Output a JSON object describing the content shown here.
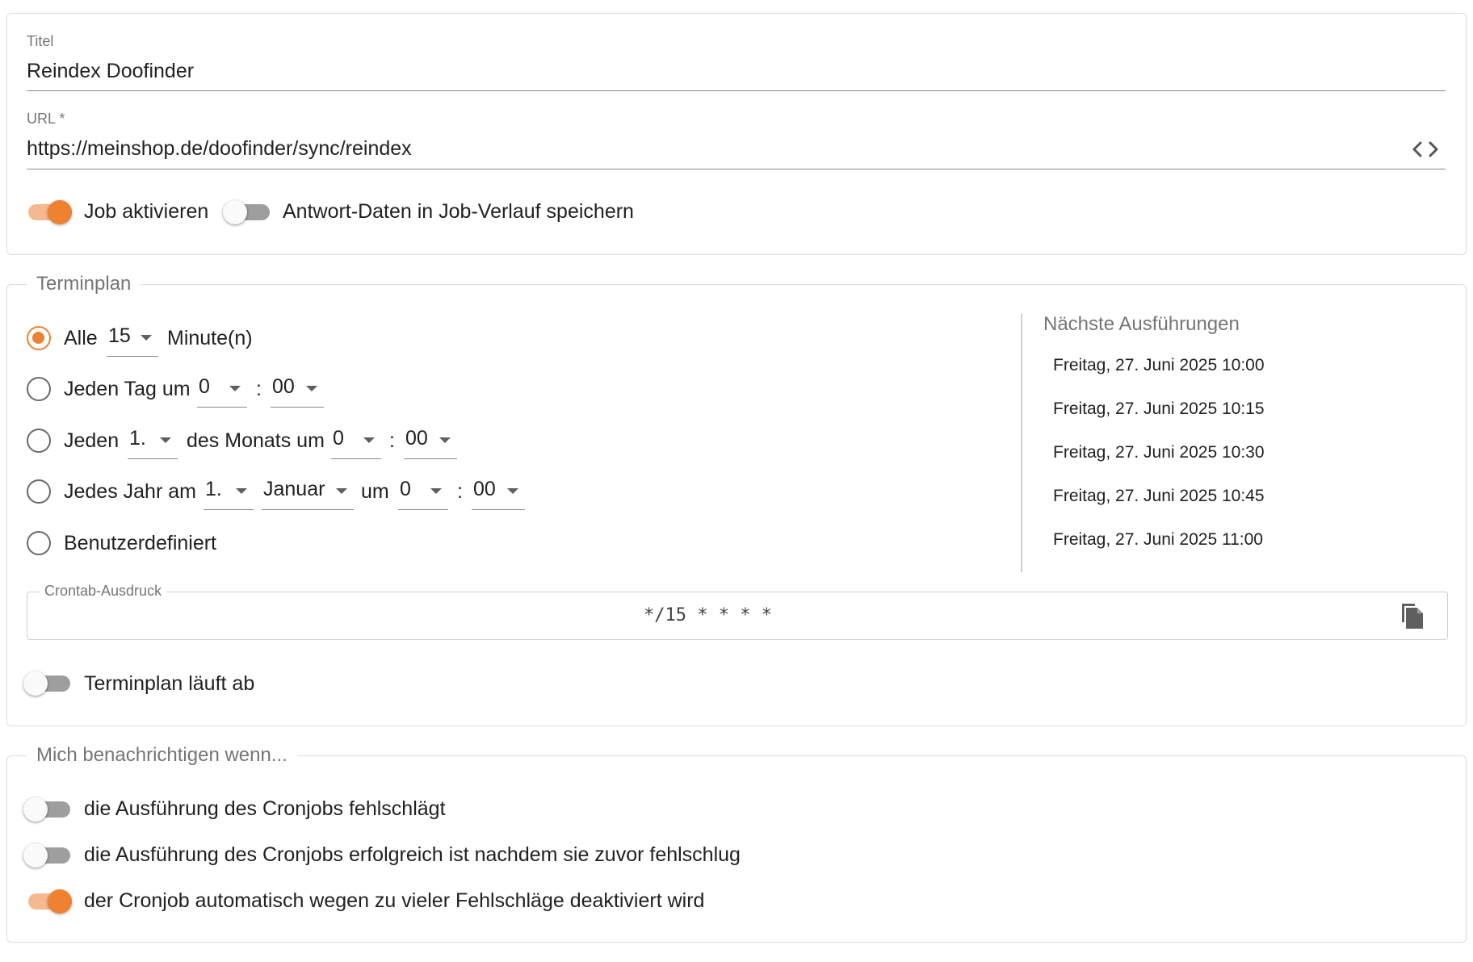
{
  "job": {
    "title_label": "Titel",
    "title_value": "Reindex Doofinder",
    "url_label": "URL *",
    "url_value": "https://meinshop.de/doofinder/sync/reindex",
    "url_icon": "code-icon",
    "enable_label": "Job aktivieren",
    "enable_on": true,
    "save_response_label": "Antwort-Daten in Job-Verlauf speichern",
    "save_response_on": false
  },
  "schedule": {
    "legend": "Terminplan",
    "every": {
      "pre": "Alle",
      "value": "15",
      "post": "Minute(n)",
      "checked": true
    },
    "daily": {
      "pre": "Jeden Tag um",
      "hour": "0",
      "sep": ":",
      "minute": "00",
      "checked": false
    },
    "monthly": {
      "pre": "Jeden",
      "day": "1.",
      "mid": "des Monats um",
      "hour": "0",
      "sep": ":",
      "minute": "00",
      "checked": false
    },
    "yearly": {
      "pre": "Jedes Jahr am",
      "day": "1.",
      "month": "Januar",
      "mid": "um",
      "hour": "0",
      "sep": ":",
      "minute": "00",
      "checked": false
    },
    "custom": {
      "label": "Benutzerdefiniert",
      "checked": false
    },
    "next_title": "Nächste Ausführungen",
    "next_runs": [
      "Freitag, 27. Juni 2025 10:00",
      "Freitag, 27. Juni 2025 10:15",
      "Freitag, 27. Juni 2025 10:30",
      "Freitag, 27. Juni 2025 10:45",
      "Freitag, 27. Juni 2025 11:00"
    ],
    "crontab_label": "Crontab-Ausdruck",
    "crontab_value": "*/15 * * * *",
    "copy_icon": "copy-icon",
    "expires_label": "Terminplan läuft ab",
    "expires_on": false
  },
  "notify": {
    "legend": "Mich benachrichtigen wenn...",
    "items": [
      {
        "label": "die Ausführung des Cronjobs fehlschlägt",
        "on": false
      },
      {
        "label": "die Ausführung des Cronjobs erfolgreich ist nachdem sie zuvor fehlschlug",
        "on": false
      },
      {
        "label": "der Cronjob automatisch wegen zu vieler Fehlschläge deaktiviert wird",
        "on": true
      }
    ]
  },
  "colors": {
    "accent": "#ef8231",
    "accent_light": "#f6b88e",
    "border": "#dcdcdc",
    "muted": "#757575"
  }
}
